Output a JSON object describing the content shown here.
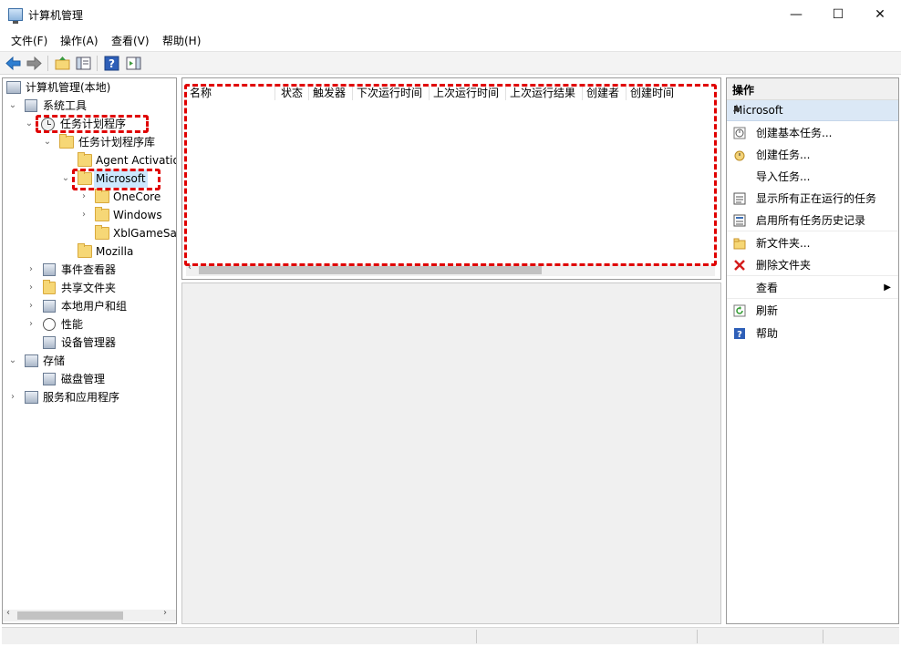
{
  "window": {
    "title": "计算机管理",
    "min": "—",
    "max": "☐",
    "close": "✕"
  },
  "menu": [
    "文件(F)",
    "操作(A)",
    "查看(V)",
    "帮助(H)"
  ],
  "tree": {
    "root": "计算机管理(本地)",
    "system_tools": "系统工具",
    "task_scheduler": "任务计划程序",
    "task_library": "任务计划程序库",
    "agent_activation": "Agent Activatio",
    "microsoft": "Microsoft",
    "onecore": "OneCore",
    "windows": "Windows",
    "xbl": "XblGameSa",
    "mozilla": "Mozilla",
    "event_viewer": "事件查看器",
    "shared_folders": "共享文件夹",
    "local_users": "本地用户和组",
    "performance": "性能",
    "device_manager": "设备管理器",
    "storage": "存储",
    "disk_management": "磁盘管理",
    "services_apps": "服务和应用程序"
  },
  "table": {
    "columns": [
      "名称",
      "状态",
      "触发器",
      "下次运行时间",
      "上次运行时间",
      "上次运行结果",
      "创建者",
      "创建时间"
    ]
  },
  "actions": {
    "header": "操作",
    "section": "Microsoft",
    "items": [
      {
        "label": "创建基本任务...",
        "icon": "basic-task-icon"
      },
      {
        "label": "创建任务...",
        "icon": "create-task-icon"
      },
      {
        "label": "导入任务...",
        "icon": ""
      },
      {
        "label": "显示所有正在运行的任务",
        "icon": "running-tasks-icon"
      },
      {
        "label": "启用所有任务历史记录",
        "icon": "history-icon"
      },
      {
        "label": "新文件夹...",
        "icon": "new-folder-icon"
      },
      {
        "label": "删除文件夹",
        "icon": "delete-icon"
      },
      {
        "label": "查看",
        "icon": ""
      },
      {
        "label": "刷新",
        "icon": "refresh-icon"
      },
      {
        "label": "帮助",
        "icon": "help-icon"
      }
    ]
  },
  "colors": {
    "highlight": "#e00000",
    "selection": "#cce8ff",
    "action_section": "#dbe8f6"
  }
}
